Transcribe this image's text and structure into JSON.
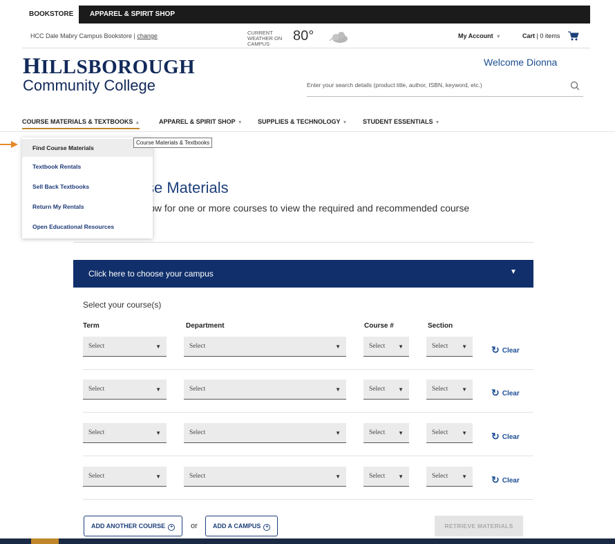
{
  "top_tabs": {
    "bookstore": "BOOKSTORE",
    "apparel": "APPAREL & SPIRIT SHOP"
  },
  "utility": {
    "store_name": "HCC Dale Mabry Campus Bookstore | ",
    "change_link": "change",
    "weather_label": "CURRENT WEATHER ON CAMPUS",
    "weather_temp": "80°",
    "weather_icon": "cloud-icon",
    "my_account": "My Account",
    "my_account_caret": "▾",
    "cart_label": "Cart",
    "cart_sep": " | ",
    "cart_count": "0 items",
    "cart_icon": "shopping-cart-icon"
  },
  "header": {
    "logo_line1_cap1": "H",
    "logo_line1_rest": "ILLSBOROUGH",
    "logo_line2": "Community College",
    "welcome": "Welcome Dionna",
    "search_placeholder": "Enter your search details (product title, author, ISBN, keyword, etc.)",
    "search_icon": "search-icon"
  },
  "nav": {
    "items": [
      {
        "label": "COURSE MATERIALS & TEXTBOOKS",
        "caret": "▲"
      },
      {
        "label": "APPAREL & SPIRIT SHOP",
        "caret": "▼"
      },
      {
        "label": "SUPPLIES & TECHNOLOGY",
        "caret": "▼"
      },
      {
        "label": "STUDENT ESSENTIALS",
        "caret": "▼"
      }
    ]
  },
  "dropdown": {
    "items": [
      "Find Course Materials",
      "Textbook Rentals",
      "Sell Back Textbooks",
      "Return My Rentals",
      "Open Educational Resources"
    ],
    "tooltip": "Course Materials & Textbooks"
  },
  "page": {
    "title": "se Materials",
    "description": "low for one or more courses to view the required and recommended course"
  },
  "campus_bar": {
    "label": "Click here to choose your campus",
    "caret": "▼"
  },
  "course_form": {
    "heading": "Select your course(s)",
    "columns": {
      "term": "Term",
      "department": "Department",
      "course": "Course #",
      "section": "Section"
    },
    "placeholder": "Select",
    "clear_label": "Clear",
    "clear_icon": "refresh-icon",
    "rows": [
      {
        "term": "Select",
        "department": "Select",
        "course": "Select",
        "section": "Select"
      },
      {
        "term": "Select",
        "department": "Select",
        "course": "Select",
        "section": "Select"
      },
      {
        "term": "Select",
        "department": "Select",
        "course": "Select",
        "section": "Select"
      },
      {
        "term": "Select",
        "department": "Select",
        "course": "Select",
        "section": "Select"
      }
    ]
  },
  "actions": {
    "add_course": "ADD ANOTHER COURSE",
    "or": "or",
    "add_campus": "ADD A CAMPUS",
    "retrieve": "RETRIEVE MATERIALS",
    "add_icon": "circle-plus-icon"
  },
  "colors": {
    "navy": "#11306b",
    "link_blue": "#1d4f96",
    "accent_gold": "#c0862a",
    "arrow_orange": "#e8892a"
  }
}
